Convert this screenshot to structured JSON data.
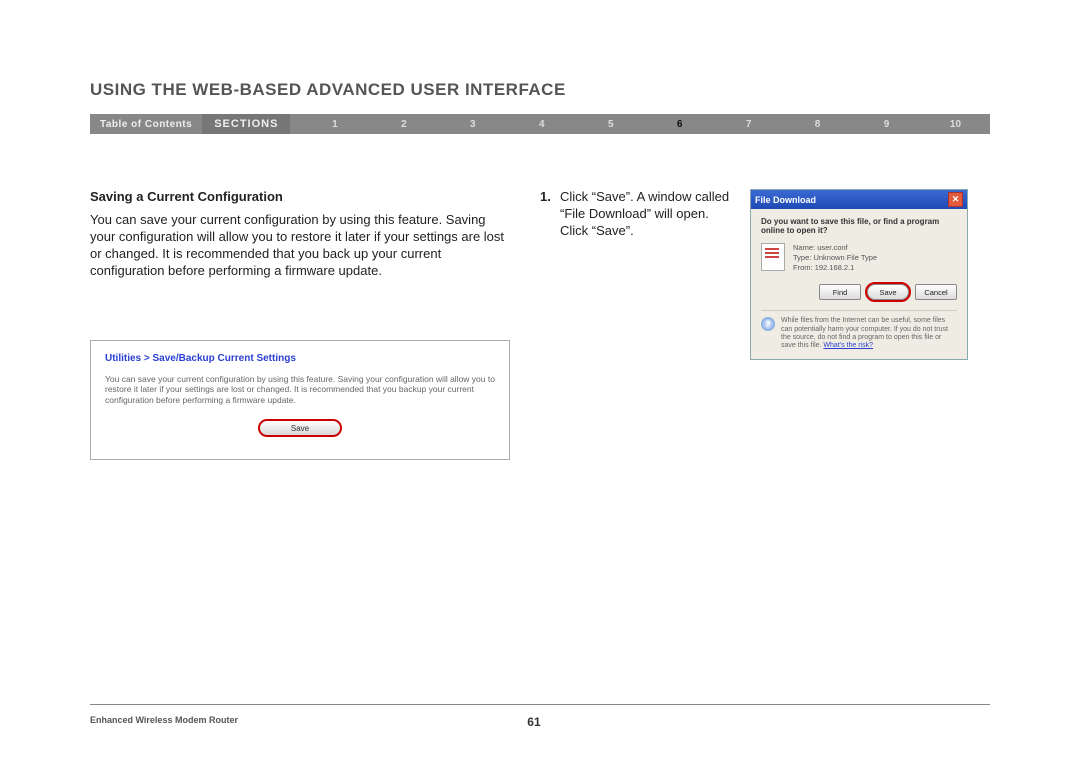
{
  "header": {
    "title": "USING THE WEB-BASED ADVANCED USER INTERFACE",
    "toc_label": "Table of Contents",
    "sections_label": "SECTIONS",
    "sections": [
      "1",
      "2",
      "3",
      "4",
      "5",
      "6",
      "7",
      "8",
      "9",
      "10"
    ],
    "current_section": "6"
  },
  "body": {
    "subhead": "Saving a Current Configuration",
    "paragraph": "You can save your current configuration by using this feature. Saving your configuration will allow you to restore it later if your settings are lost or changed. It is recommended that you back up your current configuration before performing a firmware update.",
    "step_num": "1.",
    "step_text": "Click “Save”. A window called “File Download” will open. Click “Save”."
  },
  "util_panel": {
    "title": "Utilities > Save/Backup Current Settings",
    "text": "You can save your current configuration by using this feature. Saving your configuration will allow you to restore it later if your settings are lost or changed. It is recommended that you backup your current configuration before performing a firmware update.",
    "save_label": "Save"
  },
  "dialog": {
    "title": "File Download",
    "question": "Do you want to save this file, or find a program online to open it?",
    "file_name_label": "Name:",
    "file_name": "user.conf",
    "file_type_label": "Type:",
    "file_type": "Unknown File Type",
    "file_from_label": "From:",
    "file_from": "192.168.2.1",
    "btn_find": "Find",
    "btn_save": "Save",
    "btn_cancel": "Cancel",
    "warn_text": "While files from the Internet can be useful, some files can potentially harm your computer. If you do not trust the source, do not find a program to open this file or save this file.",
    "warn_link": "What's the risk?"
  },
  "footer": {
    "product": "Enhanced Wireless Modem Router",
    "page": "61"
  }
}
